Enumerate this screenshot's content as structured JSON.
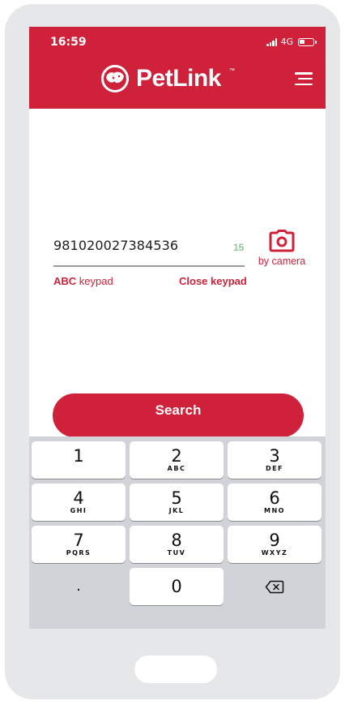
{
  "status_bar": {
    "time": "16:59",
    "network": "4G"
  },
  "header": {
    "logo_text": "PetLink",
    "logo_tm": "™"
  },
  "search": {
    "value": "981020027384536",
    "count": "15",
    "abc_keypad_bold": "ABC",
    "abc_keypad_rest": " keypad",
    "close_keypad": "Close keypad",
    "camera_label": "by camera",
    "button_label": "Search"
  },
  "keypad": {
    "rows": [
      [
        {
          "num": "1",
          "letters": ""
        },
        {
          "num": "2",
          "letters": "ABC"
        },
        {
          "num": "3",
          "letters": "DEF"
        }
      ],
      [
        {
          "num": "4",
          "letters": "GHI"
        },
        {
          "num": "5",
          "letters": "JKL"
        },
        {
          "num": "6",
          "letters": "MNO"
        }
      ],
      [
        {
          "num": "7",
          "letters": "PQRS"
        },
        {
          "num": "8",
          "letters": "TUV"
        },
        {
          "num": "9",
          "letters": "WXYZ"
        }
      ]
    ],
    "bottom": {
      "dot": ".",
      "zero": "0"
    }
  },
  "colors": {
    "brand_red": "#d0213a",
    "count_green": "#8fc49c",
    "keypad_bg": "#d1d3d9"
  },
  "icons": {
    "menu": "hamburger-menu-icon",
    "camera": "camera-icon",
    "backspace": "backspace-icon",
    "logo": "pet-logo-icon"
  }
}
